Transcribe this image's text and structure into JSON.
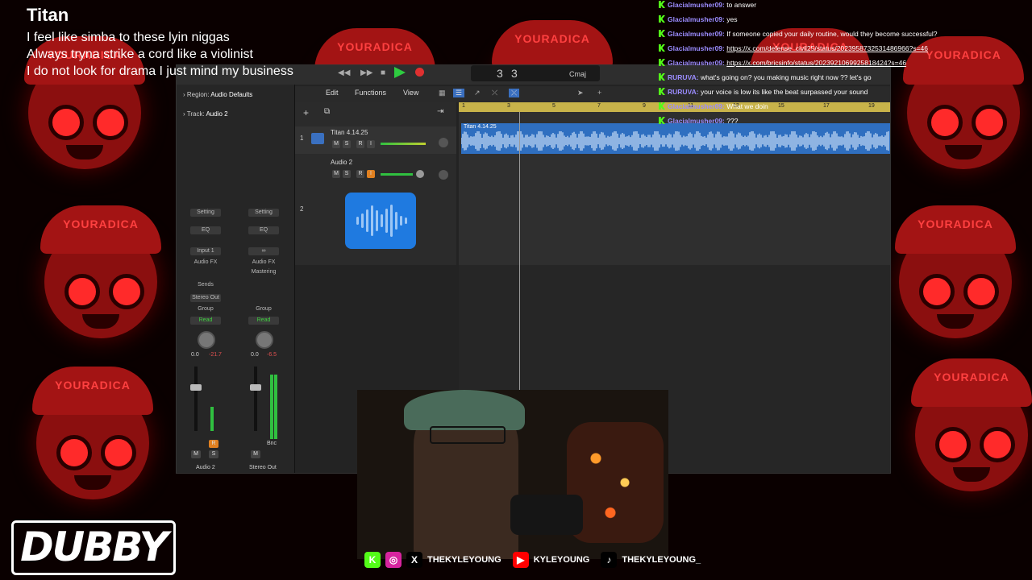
{
  "lyrics": {
    "title": "Titan",
    "lines": [
      "I feel like simba to these lyin niggas",
      "Always tryna strike a cord like a violinist",
      "I do not look for drama I just mind my business"
    ]
  },
  "background": {
    "tile_text": "YOURADICA",
    "accent": "#ff2a2a"
  },
  "daw": {
    "lcd": {
      "bar": "3",
      "beat": "3",
      "key": "Cmaj"
    },
    "menus": [
      "Edit",
      "Functions",
      "View"
    ],
    "inspector": {
      "region_label": "Region:",
      "region_value": "Audio Defaults",
      "track_label": "Track:",
      "track_value": "Audio 2",
      "strip1": {
        "setting": "Setting",
        "eq": "EQ",
        "input": "Input 1",
        "fx": "Audio FX",
        "send": "Sends",
        "output": "Stereo Out",
        "group": "Group",
        "auto": "Read",
        "val1": "0.0",
        "val2": "-21.7",
        "name": "Audio 2"
      },
      "strip2": {
        "setting": "Setting",
        "eq": "EQ",
        "fx": "Audio FX",
        "fx2": "Mastering",
        "group": "Group",
        "auto": "Read",
        "val1": "0.0",
        "val2": "-6.5",
        "name": "Stereo Out",
        "bnc": "Bnc"
      }
    },
    "tracks": [
      {
        "num": "1",
        "name": "Titan 4.14.25"
      },
      {
        "num": "",
        "name": "Audio 2"
      },
      {
        "num": "2",
        "name": ""
      }
    ],
    "ruler": [
      "1",
      "3",
      "5",
      "7",
      "9",
      "11",
      "13",
      "15",
      "17",
      "19"
    ],
    "region_name": "Titan 4.14.25"
  },
  "chat": [
    {
      "user": "Glacialmusher09:",
      "text": "to answer"
    },
    {
      "user": "Glacialmusher09:",
      "text": "yes"
    },
    {
      "user": "Glacialmusher09:",
      "text": "If someone copied your daily routine, would they become successful?"
    },
    {
      "user": "Glacialmusher09:",
      "text": "https://x.com/defense_civil25/status/2023958732531486966?s=46",
      "link": true
    },
    {
      "user": "Glacialmusher09:",
      "text": "https://x.com/bricsinfo/status/2023921069925818424?s=46",
      "link": true
    },
    {
      "user": "RURUVA:",
      "text": "what's going on? you making music right now ?? let's go"
    },
    {
      "user": "RURUVA:",
      "text": "your voice is low its like the beat surpassed your sound"
    },
    {
      "user": "Glacialmusher09:",
      "text": "What we doin"
    },
    {
      "user": "Glacialmusher09:",
      "text": "???"
    }
  ],
  "socials": [
    {
      "icon": "kick-icon",
      "color": "#53fc18",
      "glyph": "K",
      "text": ""
    },
    {
      "icon": "instagram-icon",
      "color": "#d6249f",
      "glyph": "◎",
      "text": ""
    },
    {
      "icon": "x-icon",
      "color": "#000000",
      "glyph": "X",
      "text": "THEKYLEYOUNG"
    },
    {
      "icon": "youtube-icon",
      "color": "#ff0000",
      "glyph": "▶",
      "text": "KYLEYOUNG"
    },
    {
      "icon": "tiktok-icon",
      "color": "#000000",
      "glyph": "♪",
      "text": "THEKYLEYOUNG_"
    }
  ],
  "logo": "DUBBY"
}
